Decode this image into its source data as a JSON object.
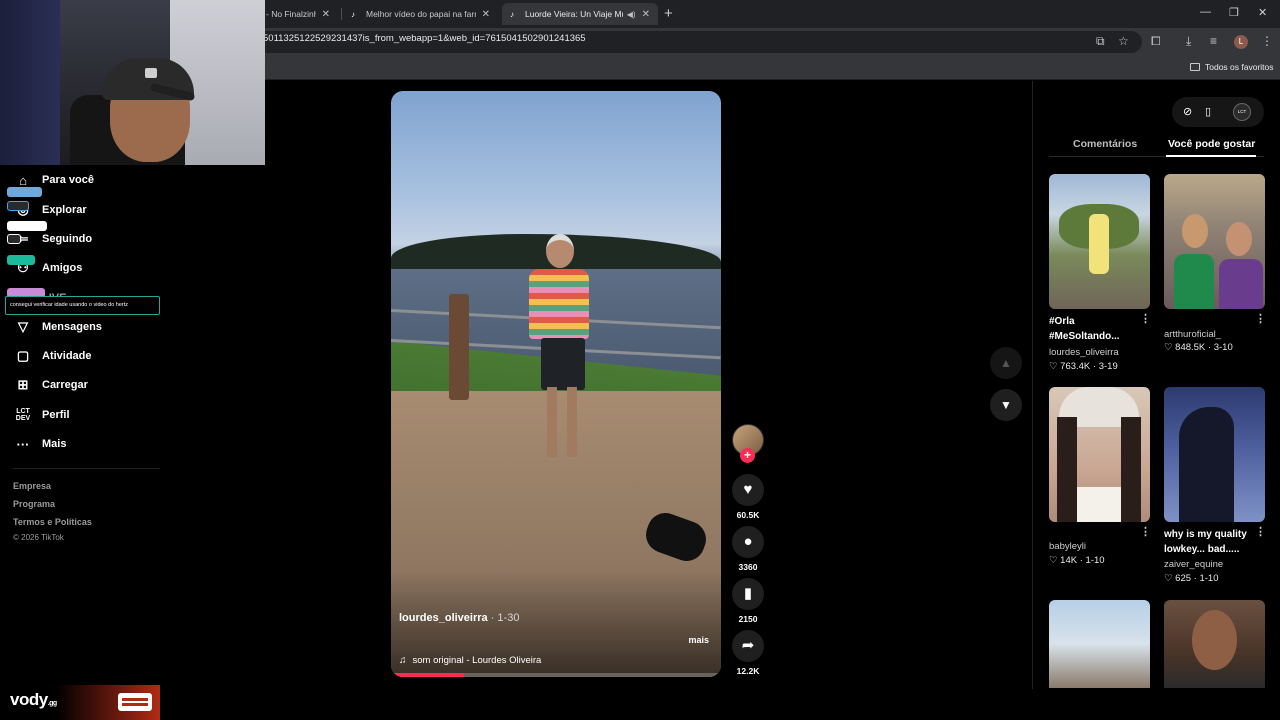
{
  "browser": {
    "tabs": [
      {
        "title": "- No Finalzinho",
        "close": "✕"
      },
      {
        "title": "Melhor vídeo do papai na farra",
        "close": "✕"
      },
      {
        "title": "Luorde Vieira: Un Viaje Mu",
        "close": "✕"
      }
    ],
    "new_tab": "+",
    "url": "5011325122529231437is_from_webapp=1&web_id=7615041502901241365",
    "bookmarks_folder": "Todos os favoritos",
    "profile_initial": "L"
  },
  "sidebar": {
    "items": [
      {
        "label": "Para você",
        "icon": "home-icon"
      },
      {
        "label": "Explorar",
        "icon": "compass-icon"
      },
      {
        "label": "Seguindo",
        "icon": "following-icon"
      },
      {
        "label": "Amigos",
        "icon": "friends-icon"
      },
      {
        "label": "LIVE",
        "icon": "live-icon"
      },
      {
        "label": "Mensagens",
        "icon": "messages-icon"
      },
      {
        "label": "Atividade",
        "icon": "activity-icon"
      },
      {
        "label": "Carregar",
        "icon": "upload-icon"
      },
      {
        "label": "Perfil",
        "icon": "profile-icon"
      },
      {
        "label": "Mais",
        "icon": "more-icon"
      }
    ],
    "footer": [
      "Empresa",
      "Programa",
      "Termos e Políticas"
    ],
    "copyright": "© 2026 TikTok"
  },
  "stream_overlay": {
    "chat_message": "consegui verificar idade usando o video do hertz",
    "brand": "vody",
    "brand_suffix": ".gg"
  },
  "video": {
    "author": "lourdes_oliveirra",
    "date": " · 1-30",
    "more": "mais",
    "sound": "som original - Lourdes Oliveira",
    "progress": 0.22,
    "likes": "60.5K",
    "comments": "3360",
    "saves": "2150",
    "shares": "12.2K"
  },
  "right_panel": {
    "tabs": [
      "Comentários",
      "Você pode gostar"
    ],
    "active_tab": 1,
    "recommendations": [
      {
        "title": "#Orla #MeSoltando...",
        "user": "lourdes_oliveirra",
        "likes": "763.4K",
        "date": "3-19"
      },
      {
        "title": "",
        "user": "artthuroficial_",
        "likes": "848.5K",
        "date": "3-10"
      },
      {
        "title": "",
        "user": "babyleyli",
        "likes": "14K",
        "date": "1-10"
      },
      {
        "title": "why is my quality lowkey... bad.....",
        "user": "zaiver_equine",
        "likes": "625",
        "date": "1-10"
      }
    ]
  },
  "colors": {
    "accent": "#fe2c55",
    "chat_border": "#26a69a"
  }
}
